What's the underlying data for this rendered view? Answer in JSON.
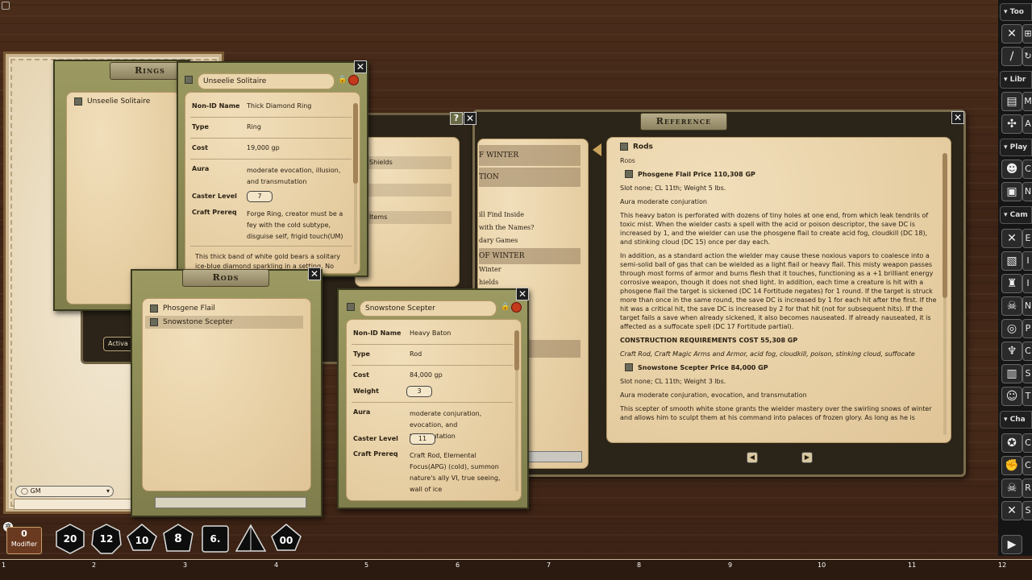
{
  "modifier": {
    "value": "0",
    "label": "Modifier"
  },
  "dice": [
    "20",
    "12",
    "10",
    "8",
    "6.",
    "",
    "00"
  ],
  "ruler": [
    "1",
    "2",
    "3",
    "4",
    "5",
    "6",
    "7",
    "8",
    "9",
    "10",
    "11",
    "12"
  ],
  "chat": {
    "identity": "GM"
  },
  "toolbar": {
    "sections": [
      "Too",
      "Libr",
      "Play",
      "Cam",
      "Cha"
    ],
    "icons": [
      "crossed-swords-icon",
      "divide-icon",
      "folder-icon",
      "puzzle-icon",
      "users-icon",
      "portrait-icon",
      "crossed-swords-icon",
      "map-icon",
      "bag-icon",
      "skull-icon",
      "coins-icon",
      "chalice-icon",
      "book-icon",
      "masks-icon",
      "shield-icon",
      "fist-icon",
      "skull-icon",
      "crossed-swords-icon",
      "play-icon"
    ]
  },
  "rings_window": {
    "title": "Rings",
    "items": [
      {
        "label": "Unseelie Solitaire"
      }
    ]
  },
  "ring_detail": {
    "name": "Unseelie Solitaire",
    "fields": [
      {
        "k": "Non-ID Name",
        "v": "Thick Diamond Ring"
      },
      {
        "k": "Type",
        "v": "Ring"
      },
      {
        "k": "Cost",
        "v": "19,000 gp"
      },
      {
        "k": "Aura",
        "v": "moderate evocation, illusion, and transmutation"
      },
      {
        "k": "Caster Level",
        "v": "7"
      },
      {
        "k": "Craft Prereq",
        "v": "Forge Ring, creator must be a fey with the cold subtype, disguise self, frigid touch(UM)"
      }
    ],
    "desc": "This thick band of white gold bears a solitary ice-blue diamond sparkling in a setting. No"
  },
  "rods_window": {
    "title": "Rods",
    "items": [
      {
        "label": "Phosgene Flail"
      },
      {
        "label": "Snowstone Scepter"
      }
    ]
  },
  "rod_detail": {
    "name": "Snowstone Scepter",
    "fields": [
      {
        "k": "Non-ID Name",
        "v": "Heavy Baton"
      },
      {
        "k": "Type",
        "v": "Rod"
      },
      {
        "k": "Cost",
        "v": "84,000 gp"
      },
      {
        "k": "Weight",
        "v": "3"
      },
      {
        "k": "Aura",
        "v": "moderate conjuration, evocation, and transmutation"
      },
      {
        "k": "Caster Level",
        "v": "11"
      },
      {
        "k": "Craft Prereq",
        "v": "Craft Rod, Elemental Focus(APG) (cold), summon nature's ally VI, true seeing, wall of ice"
      }
    ]
  },
  "book_window": {
    "left_items": [
      "Shields",
      "Items"
    ],
    "right_items": [
      "F WINTER",
      "TION",
      "ill Find Inside",
      "with the Names?",
      "dary Games",
      "OF WINTER",
      "Winter",
      "hields"
    ],
    "activate": "Activa"
  },
  "reference": {
    "title": "Reference",
    "heading": "Rods",
    "subheading": "Rods",
    "entry1_title": "Phosgene Flail Price 110,308 GP",
    "entry1_stats": "Slot none; CL 11th; Weight 5 lbs.",
    "entry1_aura": "Aura moderate conjuration",
    "entry1_p1": "This heavy baton is perforated with dozens of tiny holes at one end, from which leak tendrils of toxic mist. When the wielder casts a spell with the acid or poison descriptor, the save DC is increased by 1, and the wielder can use the phosgene flail to create acid fog, cloudkill (DC 18), and stinking cloud (DC 15) once per day each.",
    "entry1_p2": "In addition, as a standard action the wielder may cause these noxious vapors to coalesce into a semi-solid ball of gas that can be wielded as a light flail or heavy flail. This misty weapon passes through most forms of armor and burns flesh that it touches, functioning as a +1 brilliant energy corrosive weapon, though it does not shed light. In addition, each time a creature is hit with a phosgene flail the target is sickened (DC 14 Fortitude negates) for 1 round. If the target is struck more than once in the same round, the save DC is increased by 1 for each hit after the first. If the hit was a critical hit, the save DC is increased by 2 for that hit (not for subsequent hits). If the target fails a save when already sickened, it also becomes nauseated. If already nauseated, it is affected as a suffocate spell (DC 17 Fortitude partial).",
    "entry1_constr": "CONSTRUCTION REQUIREMENTS COST 55,308 GP",
    "entry1_craft": "Craft Rod, Craft Magic Arms and Armor, acid fog, cloudkill, poison, stinking cloud, suffocate",
    "entry2_title": "Snowstone Scepter Price 84,000 GP",
    "entry2_stats": "Slot none; CL 11th; Weight 3 lbs.",
    "entry2_aura": "Aura moderate conjuration, evocation, and transmutation",
    "entry2_p1": "This scepter of smooth white stone grants the wielder mastery over the swirling snows of winter and allows him to sculpt them at his command into palaces of frozen glory. As long as he is"
  }
}
